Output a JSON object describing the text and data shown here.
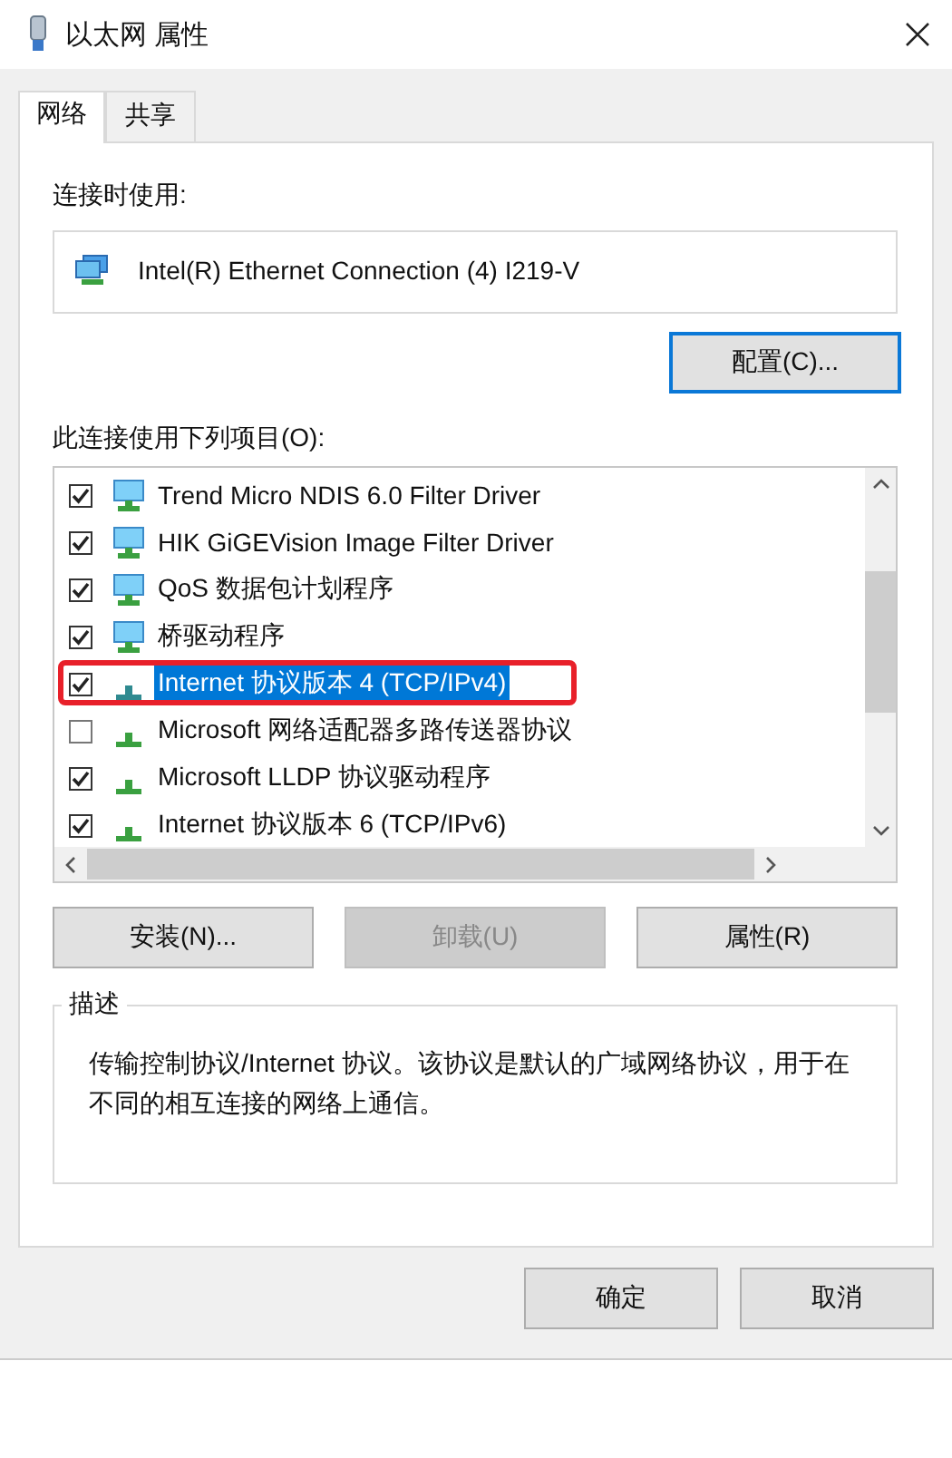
{
  "window": {
    "title": "以太网 属性"
  },
  "tabs": [
    {
      "label": "网络",
      "selected": true
    },
    {
      "label": "共享",
      "selected": false
    }
  ],
  "connect_using": {
    "label": "连接时使用:",
    "adapter": "Intel(R) Ethernet Connection (4) I219-V"
  },
  "configure_button": {
    "label": "配置(C)...",
    "focused": true
  },
  "items_label": "此连接使用下列项目(O):",
  "items": [
    {
      "kind": "service",
      "label": "Trend Micro NDIS 6.0 Filter Driver",
      "checked": true,
      "selected": false,
      "highlighted": false
    },
    {
      "kind": "service",
      "label": "HIK GiGEVision Image Filter Driver",
      "checked": true,
      "selected": false,
      "highlighted": false
    },
    {
      "kind": "service",
      "label": "QoS 数据包计划程序",
      "checked": true,
      "selected": false,
      "highlighted": false
    },
    {
      "kind": "service",
      "label": "桥驱动程序",
      "checked": true,
      "selected": false,
      "highlighted": false
    },
    {
      "kind": "protocol",
      "label": "Internet 协议版本 4 (TCP/IPv4)",
      "checked": true,
      "selected": true,
      "highlighted": true
    },
    {
      "kind": "protocol",
      "label": "Microsoft 网络适配器多路传送器协议",
      "checked": false,
      "selected": false,
      "highlighted": false
    },
    {
      "kind": "protocol",
      "label": "Microsoft LLDP 协议驱动程序",
      "checked": true,
      "selected": false,
      "highlighted": false
    },
    {
      "kind": "protocol",
      "label": "Internet 协议版本 6 (TCP/IPv6)",
      "checked": true,
      "selected": false,
      "highlighted": false
    }
  ],
  "item_buttons": [
    {
      "label": "安装(N)...",
      "disabled": false
    },
    {
      "label": "卸载(U)",
      "disabled": true
    },
    {
      "label": "属性(R)",
      "disabled": false
    }
  ],
  "description": {
    "title": "描述",
    "text": "传输控制协议/Internet 协议。该协议是默认的广域网络协议，用于在不同的相互连接的网络上通信。"
  },
  "dialog_buttons": [
    {
      "label": "确定"
    },
    {
      "label": "取消"
    }
  ]
}
